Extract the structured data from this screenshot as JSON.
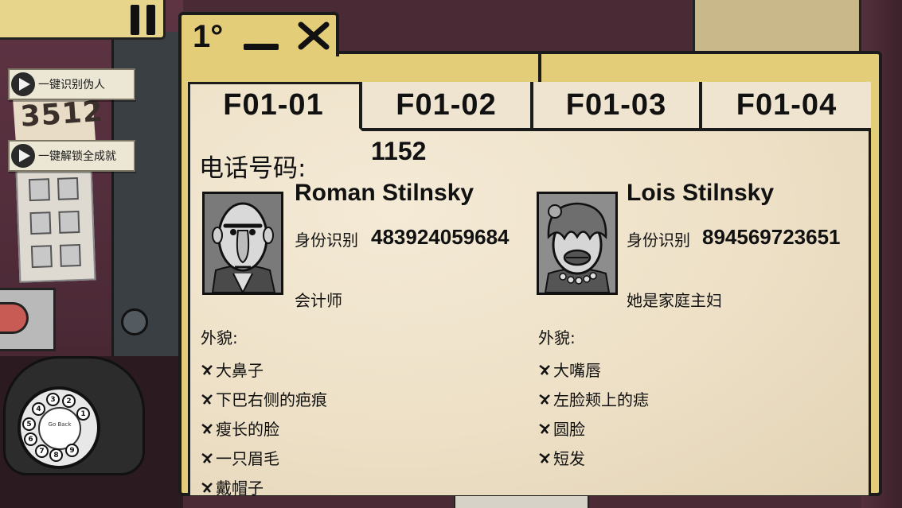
{
  "window": {
    "index_label": "1°",
    "minimize_label": "_",
    "close_label": "×"
  },
  "cheats": [
    {
      "label": "一键识别伪人"
    },
    {
      "label": "一键解锁全成就"
    }
  ],
  "background": {
    "paper_numbers": "3512",
    "phone_dial_center": "Go Back",
    "phone_dial_digits": [
      "1",
      "2",
      "3",
      "4",
      "5",
      "6",
      "7",
      "8",
      "9"
    ]
  },
  "tabs": [
    {
      "label": "F01-01",
      "active": true
    },
    {
      "label": "F01-02",
      "active": false
    },
    {
      "label": "F01-03",
      "active": false
    },
    {
      "label": "F01-04",
      "active": false
    }
  ],
  "phone": {
    "label": "电话号码:",
    "value": "1152"
  },
  "residents": [
    {
      "name": "Roman Stilnsky",
      "id_label": "身份识别",
      "id_value": "483924059684",
      "job": "会计师",
      "appearance_label": "外貌:",
      "traits": [
        "大鼻子",
        "下巴右侧的疤痕",
        "瘦长的脸",
        "一只眉毛",
        "戴帽子"
      ],
      "portrait_icon": "bald-man-portrait"
    },
    {
      "name": "Lois Stilnsky",
      "id_label": "身份识别",
      "id_value": "894569723651",
      "job": "她是家庭主妇",
      "appearance_label": "外貌:",
      "traits": [
        "大嘴唇",
        "左脸颊上的痣",
        "圆脸",
        "短发"
      ],
      "portrait_icon": "curly-hair-woman-portrait"
    }
  ],
  "colors": {
    "folder": "#e4cd78",
    "paper": "#efe3cc",
    "ink": "#111111"
  }
}
